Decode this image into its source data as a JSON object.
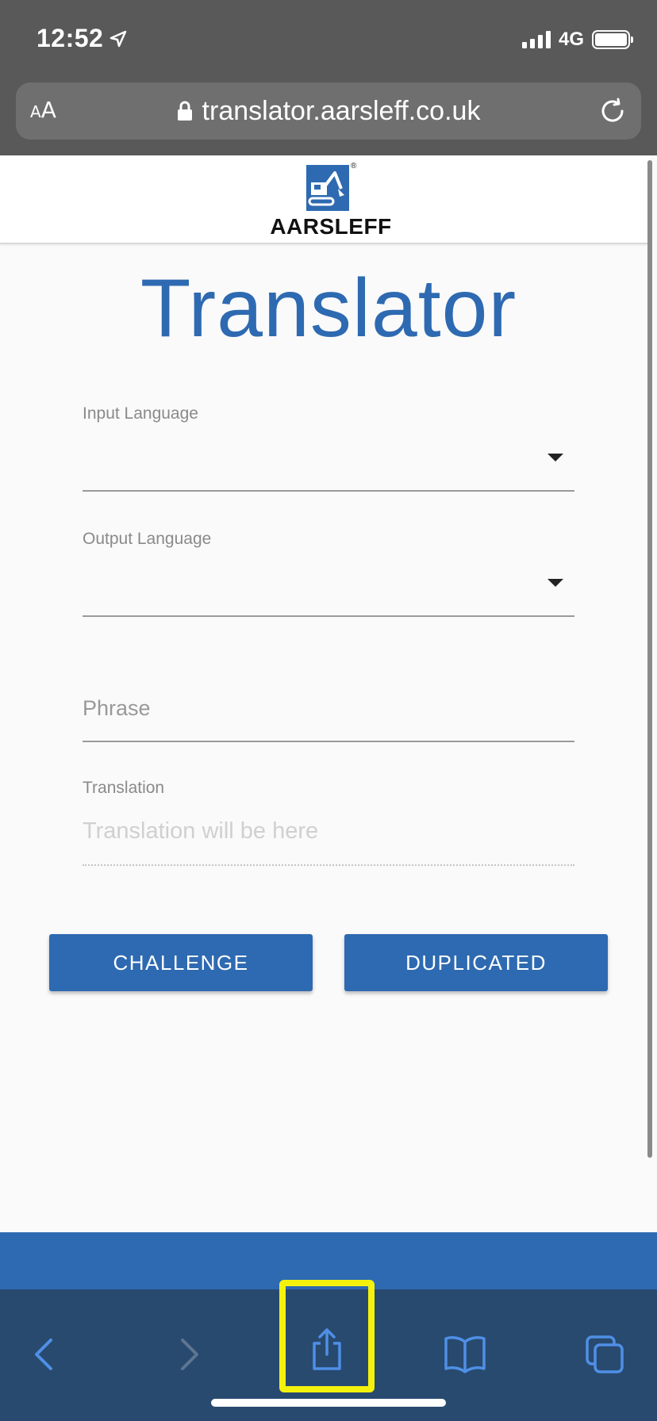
{
  "status_bar": {
    "time": "12:52",
    "network": "4G",
    "icons": [
      "location-arrow-icon",
      "signal-icon",
      "battery-icon"
    ]
  },
  "browser": {
    "text_size_small": "A",
    "text_size_big": "A",
    "url": "translator.aarsleff.co.uk",
    "icons": [
      "lock-icon",
      "reload-icon"
    ]
  },
  "header": {
    "logo_text": "AARSLEFF",
    "logo_reg": "®"
  },
  "main": {
    "title": "Translator",
    "input_language": {
      "label": "Input Language",
      "value": ""
    },
    "output_language": {
      "label": "Output Language",
      "value": ""
    },
    "phrase": {
      "placeholder": "Phrase",
      "value": ""
    },
    "translation": {
      "label": "Translation",
      "placeholder": "Translation will be here"
    },
    "buttons": {
      "challenge": "CHALLENGE",
      "duplicated": "DUPLICATED"
    }
  },
  "toolbar": {
    "items": [
      "back-icon",
      "forward-icon",
      "share-icon",
      "bookmarks-icon",
      "tabs-icon"
    ]
  },
  "colors": {
    "brand_blue": "#2e6ab1",
    "toolbar": "#284a6f",
    "chrome": "#595959",
    "highlight": "#f4f20c"
  }
}
